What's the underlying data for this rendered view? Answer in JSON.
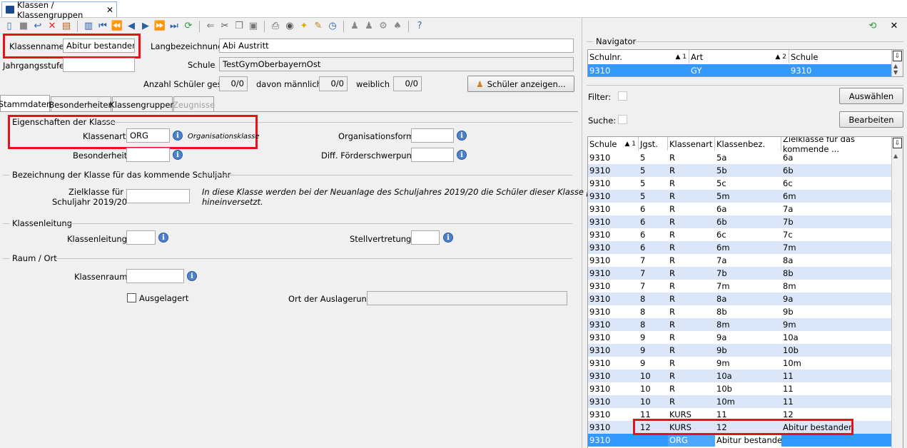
{
  "tab": {
    "title": "Klassen / Klassengruppen"
  },
  "form": {
    "klassenname_label": "Klassenname",
    "klassenname_value": "Abitur bestanden",
    "langbezeichnung_label": "Langbezeichnung",
    "langbezeichnung_value": "Abi Austritt",
    "jahrgangsstufe_label": "Jahrgangsstufe",
    "jahrgangsstufe_value": "",
    "schule_label": "Schule",
    "schule_value": "TestGymOberbayernOst",
    "anzahl_label": "Anzahl Schüler ges.",
    "anzahl_value": "0/0",
    "maennlich_label": "davon männlich",
    "maennlich_value": "0/0",
    "weiblich_label": "weiblich",
    "weiblich_value": "0/0",
    "schueler_button": "Schüler anzeigen..."
  },
  "subtabs": [
    "Stammdaten",
    "Besonderheiten",
    "Klassengruppen",
    "Zeugnisse"
  ],
  "eigenschaften": {
    "title": "Eigenschaften der Klasse",
    "klassenart_label": "Klassenart",
    "klassenart_value": "ORG",
    "klassenart_hint": "Organisationsklasse",
    "organisationsform_label": "Organisationsform",
    "besonderheit_label": "Besonderheit",
    "diff_label": "Diff. Förderschwerpunkt"
  },
  "bezeichnung": {
    "title": "Bezeichnung der Klasse für das kommende Schuljahr",
    "zielklasse_label_1": "Zielklasse für",
    "zielklasse_label_2": "Schuljahr 2019/20",
    "hint_1": "In diese Klasse werden bei der Neuanlage des Schuljahres 2019/20 die Schüler dieser Klasse pauschal",
    "hint_2": "hineinversetzt."
  },
  "klassenleitung": {
    "title": "Klassenleitung",
    "klassenleitung_label": "Klassenleitung",
    "stellvertretung_label": "Stellvertretung"
  },
  "raum": {
    "title": "Raum / Ort",
    "klassenraum_label": "Klassenraum",
    "ausgelagert_label": "Ausgelagert",
    "ort_label": "Ort der Auslagerung"
  },
  "navigator": {
    "title": "Navigator",
    "headers": [
      "Schulnr.",
      "Art",
      "Schule"
    ],
    "sort1": "▲ 1",
    "sort2": "▲ 2",
    "row": [
      "9310",
      "GY",
      "9310"
    ],
    "filter_label": "Filter:",
    "suche_label": "Suche:",
    "auswaehlen_button": "Auswählen",
    "bearbeiten_button": "Bearbeiten"
  },
  "klassen_table": {
    "headers": [
      "Schule",
      "Jgst.",
      "Klassenart",
      "Klassenbez.",
      "Zielklasse für das kommende ..."
    ],
    "sort1": "▲ 1",
    "rows": [
      [
        "9310",
        "5",
        "R",
        "5a",
        "6a"
      ],
      [
        "9310",
        "5",
        "R",
        "5b",
        "6b"
      ],
      [
        "9310",
        "5",
        "R",
        "5c",
        "6c"
      ],
      [
        "9310",
        "5",
        "R",
        "5m",
        "6m"
      ],
      [
        "9310",
        "6",
        "R",
        "6a",
        "7a"
      ],
      [
        "9310",
        "6",
        "R",
        "6b",
        "7b"
      ],
      [
        "9310",
        "6",
        "R",
        "6c",
        "7c"
      ],
      [
        "9310",
        "6",
        "R",
        "6m",
        "7m"
      ],
      [
        "9310",
        "7",
        "R",
        "7a",
        "8a"
      ],
      [
        "9310",
        "7",
        "R",
        "7b",
        "8b"
      ],
      [
        "9310",
        "7",
        "R",
        "7m",
        "8m"
      ],
      [
        "9310",
        "8",
        "R",
        "8a",
        "9a"
      ],
      [
        "9310",
        "8",
        "R",
        "8b",
        "9b"
      ],
      [
        "9310",
        "8",
        "R",
        "8m",
        "9m"
      ],
      [
        "9310",
        "9",
        "R",
        "9a",
        "10a"
      ],
      [
        "9310",
        "9",
        "R",
        "9b",
        "10b"
      ],
      [
        "9310",
        "9",
        "R",
        "9m",
        "10m"
      ],
      [
        "9310",
        "10",
        "R",
        "10a",
        "11"
      ],
      [
        "9310",
        "10",
        "R",
        "10b",
        "11"
      ],
      [
        "9310",
        "10",
        "R",
        "10m",
        "11"
      ],
      [
        "9310",
        "11",
        "KURS",
        "11",
        "12"
      ],
      [
        "9310",
        "12",
        "KURS",
        "12",
        "Abitur bestanden"
      ],
      [
        "9310",
        "",
        "ORG",
        "Abitur bestanden",
        ""
      ]
    ]
  },
  "colors": {
    "accent": "#3399ff",
    "highlight_red": "#e8101a",
    "stripe": "#dbe6f8"
  }
}
